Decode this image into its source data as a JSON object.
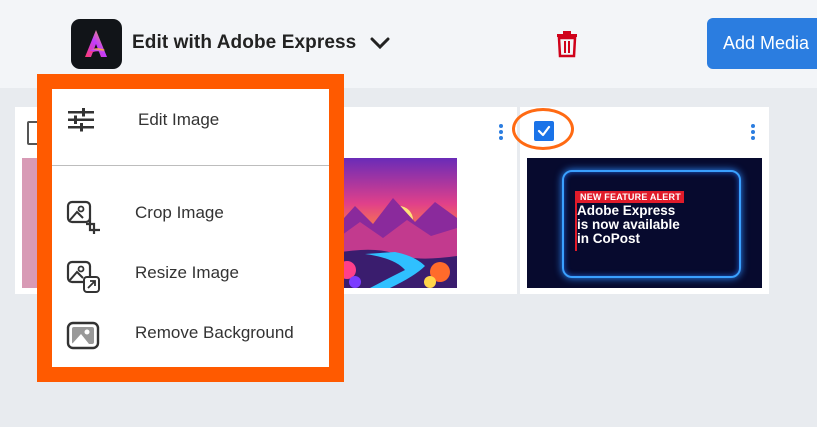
{
  "header": {
    "brand_title": "Edit with Adobe Express",
    "add_media_label": "Add Media"
  },
  "menu": {
    "items": [
      {
        "label": "Edit Image",
        "icon": "sliders-icon"
      },
      {
        "label": "Crop Image",
        "icon": "crop-image-icon"
      },
      {
        "label": "Resize Image",
        "icon": "resize-image-icon"
      },
      {
        "label": "Remove Background",
        "icon": "remove-background-icon"
      }
    ]
  },
  "media": {
    "cards": [
      {
        "checked": false
      },
      {
        "checked": true,
        "promo_alert": "NEW FEATURE ALERT",
        "promo_line1": "Adobe Express",
        "promo_line2": "is now available",
        "promo_line3": "in CoPost"
      }
    ]
  },
  "colors": {
    "accent": "#2b7de0",
    "highlight": "#ff5a00",
    "delete": "#d0021b"
  }
}
